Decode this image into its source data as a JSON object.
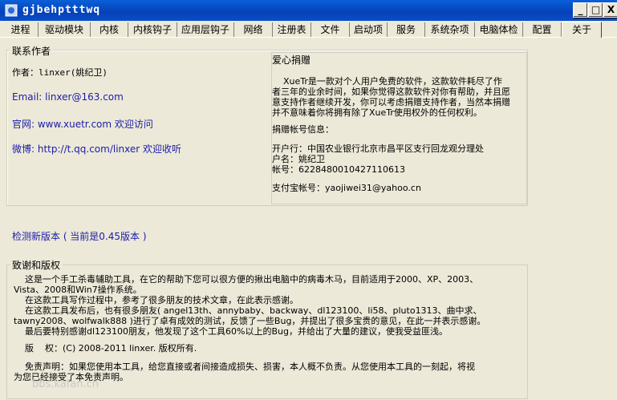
{
  "window": {
    "title": "gjbehptttwq",
    "minimize": "_",
    "maximize": "□",
    "close": "X"
  },
  "tabs": [
    "进程",
    "驱动模块",
    "内核",
    "内核钩子",
    "应用层钩子",
    "网络",
    "注册表",
    "文件",
    "启动项",
    "服务",
    "系统杂项",
    "电脑体检",
    "配置",
    "关于"
  ],
  "contact": {
    "group_label": "联系作者",
    "author": "作者：linxer(姚纪卫)",
    "email": "Email: linxer@163.com",
    "website": "官网: www.xuetr.com 欢迎访问",
    "weibo": "微博: http://t.qq.com/linxer 欢迎收听"
  },
  "donate": {
    "title": "爱心捐赠",
    "p1": "    XueTr是一款对个人用户免费的软件，这款软件耗尽了作",
    "p2": "者三年的业余时间，如果你觉得这款软件对你有帮助，并且愿",
    "p3": "意支持作者继续开发，你可以考虑捐赠支持作者，当然本捐赠",
    "p4": "并不意味着你将拥有除了XueTr使用权外的任何权利。",
    "account_header": "捐赠帐号信息：",
    "bank": "开户行：中国农业银行北京市昌平区支行回龙观分理处",
    "name": "户名：姚纪卫",
    "account": "帐号：6228480010427110613",
    "alipay": "支付宝帐号：yaojiwei31@yahoo.cn"
  },
  "check_update": "检测新版本 ( 当前是0.45版本 )",
  "thanks": {
    "group_label": "致谢和版权",
    "lines": [
      "    这是一个手工杀毒辅助工具，在它的帮助下您可以很方便的揪出电脑中的病毒木马，目前适用于2000、XP、2003、",
      "Vista、2008和Win7操作系统。",
      "    在这款工具写作过程中，参考了很多朋友的技术文章，在此表示感谢。",
      "    在这款工具发布后，也有很多朋友( angel13th、annybaby、backway、dl123100、li58、pluto1313、曲中求、",
      "tawny2008、wolfwalk888 )进行了卓有成效的测试，反馈了一些Bug，并提出了很多宝贵的意见，在此一并表示感谢。",
      "    最后要特别感谢dl123100朋友，他发现了这个工具60%以上的Bug，并给出了大量的建议，使我受益匪浅。",
      "",
      "    版    权：(C) 2008-2011 linxer. 版权所有.",
      "",
      "    免责声明：如果您使用本工具，给您直接或者间接造成损失、损害，本人概不负责。从您使用本工具的一刻起，将视",
      "为您已经接受了本免责声明。"
    ]
  },
  "watermark": "bbs.kafan.cn"
}
